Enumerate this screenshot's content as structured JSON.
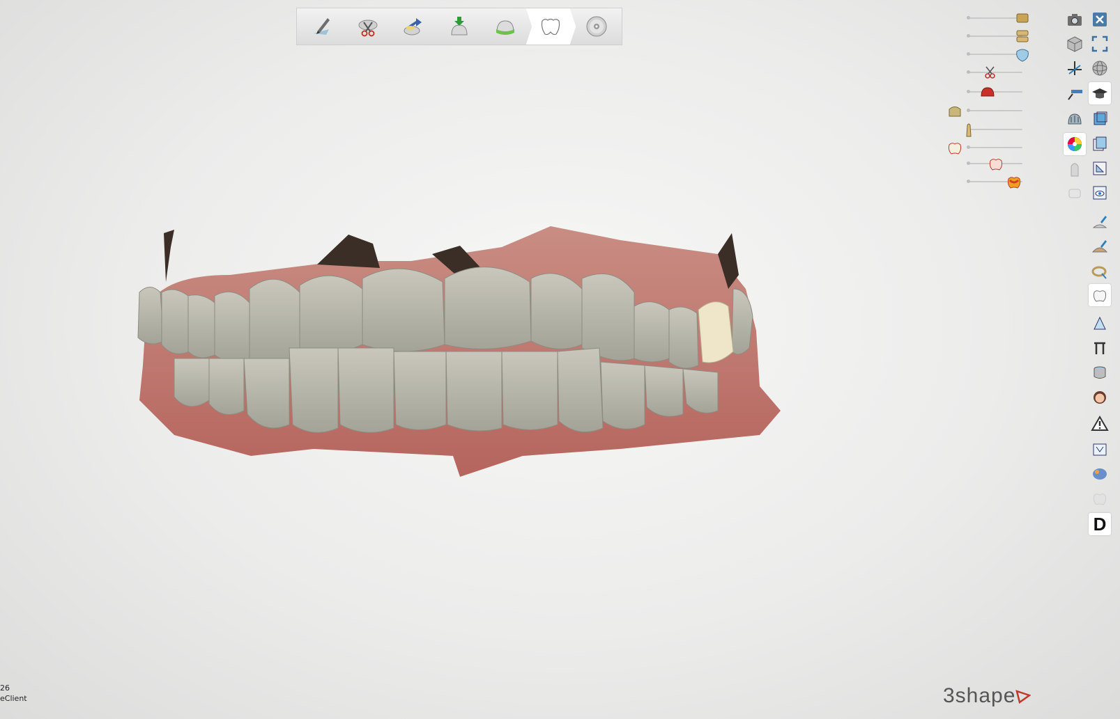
{
  "workflow": {
    "steps": [
      {
        "name": "margin-line-step",
        "icon": "pen-margin-icon"
      },
      {
        "name": "trim-step",
        "icon": "scissors-model-icon"
      },
      {
        "name": "insertion-direction-step",
        "icon": "insertion-arrow-icon"
      },
      {
        "name": "die-spacer-step",
        "icon": "die-download-icon"
      },
      {
        "name": "coping-step",
        "icon": "coping-band-icon"
      },
      {
        "name": "anatomy-step",
        "icon": "crown-anatomy-icon",
        "active": true
      },
      {
        "name": "save-step",
        "icon": "disc-icon"
      }
    ]
  },
  "visibility_sliders": [
    {
      "name": "upper-die-visibility",
      "value": 1.0
    },
    {
      "name": "upper-model-visibility",
      "value": 1.0
    },
    {
      "name": "antagonist-visibility",
      "value": 1.0
    },
    {
      "name": "cut-plane-visibility",
      "value": 0.4
    },
    {
      "name": "gingiva-visibility",
      "value": 0.35
    },
    {
      "name": "coping-visibility",
      "value": 0.0
    },
    {
      "name": "post-visibility",
      "value": 0.0
    },
    {
      "name": "crown-section-visibility",
      "value": 0.0
    },
    {
      "name": "crown-visibility",
      "value": 0.5
    },
    {
      "name": "heatmap-visibility",
      "value": 0.85
    }
  ],
  "tools_left_column": [
    "camera-icon",
    "cube-view-icon",
    "axis-cross-icon",
    "ruler-measure-icon",
    "jaw-view-icon",
    "color-wheel-icon",
    "transparent-tooth-icon",
    "transparent-arch-icon"
  ],
  "tools_right_column": [
    "close-icon",
    "fullscreen-icon",
    "rotate-sphere-icon",
    "graduation-cap-icon",
    "view-front-icon",
    "view-side-icon",
    "view-corner-icon",
    "view-eye-icon",
    "sculpt-add-icon",
    "sculpt-smooth-icon",
    "sculpt-ring-icon",
    "crown-select-icon",
    "cusp-tool-icon",
    "section-tool-icon",
    "cylinder-tool-icon",
    "face-photo-icon",
    "warning-icon",
    "clipping-box-icon",
    "morph-tool-icon",
    "ghost-tooth-icon",
    "letter-d-icon"
  ],
  "tool_letter": "D",
  "status": {
    "line1": "26",
    "line2": "eClient"
  },
  "brand": {
    "name": "3shape"
  },
  "colors": {
    "accent": "#c0392b",
    "gingiva": "#b96a5f",
    "tooth": "#b9b8ad",
    "crown": "#efe6c9"
  }
}
